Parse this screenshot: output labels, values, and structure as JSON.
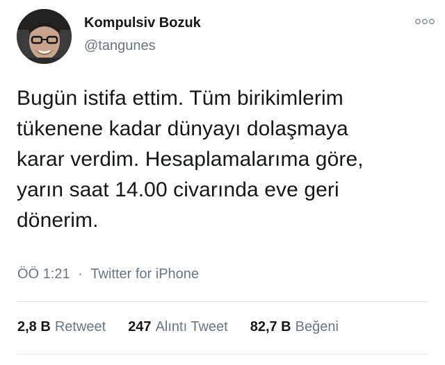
{
  "author": {
    "display_name": "Kompulsiv Bozuk",
    "handle": "@tangunes",
    "avatar_icon": "user-avatar"
  },
  "tweet": {
    "text": "Bugün istifa ettim. Tüm birikimlerim\ntükenene kadar dünyayı dolaşmaya\nkarar verdim. Hesaplamalarıma göre,\nyarın saat 14.00 civarında eve geri\ndönerim."
  },
  "meta": {
    "time": "ÖÖ 1:21",
    "separator": "·",
    "source": "Twitter for iPhone"
  },
  "stats": {
    "retweets": {
      "count": "2,8 B",
      "label": "Retweet"
    },
    "quotes": {
      "count": "247",
      "label": "Alıntı Tweet"
    },
    "likes": {
      "count": "82,7 B",
      "label": "Beğeni"
    }
  },
  "more_icon": "more-options-icon",
  "colors": {
    "text_primary": "#14171a",
    "text_secondary": "#657786",
    "divider": "#e1e8ed"
  }
}
